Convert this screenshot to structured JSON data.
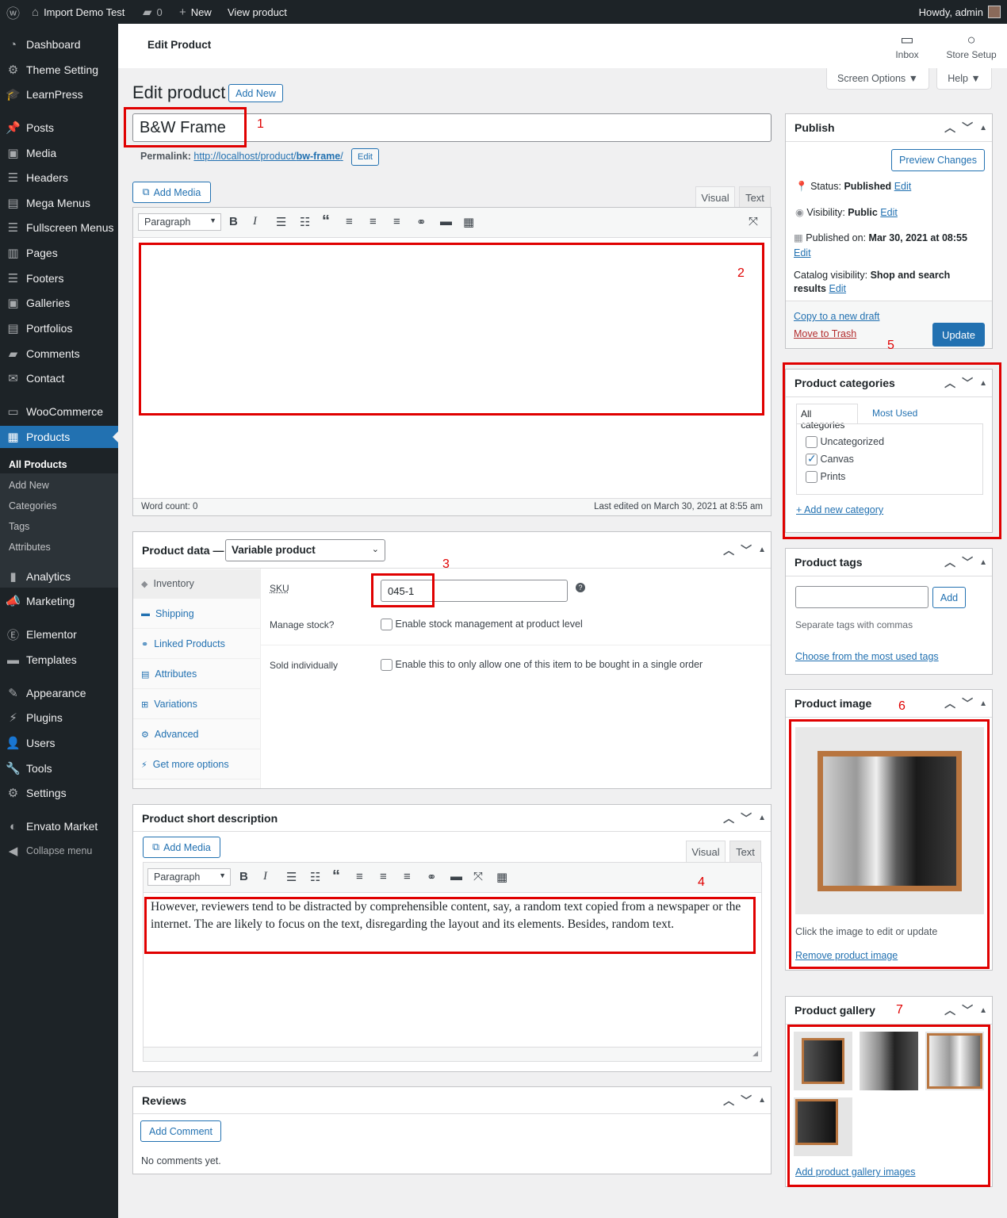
{
  "adminbar": {
    "site": "Import Demo Test",
    "comments": "0",
    "new": "New",
    "view": "View product",
    "howdy": "Howdy, admin"
  },
  "menu": {
    "dashboard": "Dashboard",
    "theme_setting": "Theme Setting",
    "learnpress": "LearnPress",
    "posts": "Posts",
    "media": "Media",
    "headers": "Headers",
    "mega_menus": "Mega Menus",
    "fullscreen_menus": "Fullscreen Menus",
    "pages": "Pages",
    "footers": "Footers",
    "galleries": "Galleries",
    "portfolios": "Portfolios",
    "comments": "Comments",
    "contact": "Contact",
    "woocommerce": "WooCommerce",
    "products": "Products",
    "all_products": "All Products",
    "add_new": "Add New",
    "categories": "Categories",
    "tags": "Tags",
    "attributes": "Attributes",
    "analytics": "Analytics",
    "marketing": "Marketing",
    "elementor": "Elementor",
    "templates": "Templates",
    "appearance": "Appearance",
    "plugins": "Plugins",
    "users": "Users",
    "tools": "Tools",
    "settings": "Settings",
    "envato": "Envato Market",
    "collapse": "Collapse menu"
  },
  "header": {
    "title": "Edit Product",
    "inbox": "Inbox",
    "store_setup": "Store Setup",
    "screen_options": "Screen Options ▼",
    "help": "Help ▼"
  },
  "page": {
    "heading": "Edit product",
    "add_new": "Add New"
  },
  "product": {
    "title": "B&W Frame",
    "permalink_label": "Permalink:",
    "permalink_prefix": "http://localhost/product/",
    "permalink_slug": "bw-frame",
    "permalink_suffix": "/",
    "edit": "Edit"
  },
  "editor": {
    "add_media": "Add Media",
    "visual": "Visual",
    "text": "Text",
    "format": "Paragraph",
    "word_count": "Word count: 0",
    "last_edited": "Last edited on March 30, 2021 at 8:55 am"
  },
  "product_data": {
    "label": "Product data —",
    "type": "Variable product",
    "tabs": [
      "Inventory",
      "Shipping",
      "Linked Products",
      "Attributes",
      "Variations",
      "Advanced",
      "Get more options"
    ],
    "sku_label": "SKU",
    "sku_value": "045-1",
    "manage_stock_label": "Manage stock?",
    "manage_stock_text": "Enable stock management at product level",
    "sold_ind_label": "Sold individually",
    "sold_ind_text": "Enable this to only allow one of this item to be bought in a single order"
  },
  "short_desc": {
    "title": "Product short description",
    "add_media": "Add Media",
    "visual": "Visual",
    "text": "Text",
    "format": "Paragraph",
    "content": "However, reviewers tend to be distracted by comprehensible content, say, a random text copied from a newspaper or the internet. The are likely to focus on the text, disregarding the layout and its elements. Besides, random text."
  },
  "reviews": {
    "title": "Reviews",
    "add_comment": "Add Comment",
    "none": "No comments yet."
  },
  "publish": {
    "title": "Publish",
    "preview": "Preview Changes",
    "status_label": "Status:",
    "status": "Published",
    "visibility_label": "Visibility:",
    "visibility": "Public",
    "published_label": "Published on:",
    "published": "Mar 30, 2021 at 08:55",
    "catalog_label": "Catalog visibility:",
    "catalog": "Shop and search results",
    "edit": "Edit",
    "copy": "Copy to a new draft",
    "trash": "Move to Trash",
    "update": "Update"
  },
  "categories": {
    "title": "Product categories",
    "tab_all": "All categories",
    "tab_most": "Most Used",
    "items": [
      "Uncategorized",
      "Canvas",
      "Prints"
    ],
    "add": "+ Add new category"
  },
  "tags": {
    "title": "Product tags",
    "add": "Add",
    "hint": "Separate tags with commas",
    "choose": "Choose from the most used tags"
  },
  "image": {
    "title": "Product image",
    "hint": "Click the image to edit or update",
    "remove": "Remove product image"
  },
  "gallery": {
    "title": "Product gallery",
    "add": "Add product gallery images"
  },
  "annotations": [
    "1",
    "2",
    "3",
    "4",
    "5",
    "6",
    "7"
  ],
  "colors": {
    "accent": "#2271b1",
    "annotation": "#e00000",
    "sidebar": "#1d2327"
  }
}
